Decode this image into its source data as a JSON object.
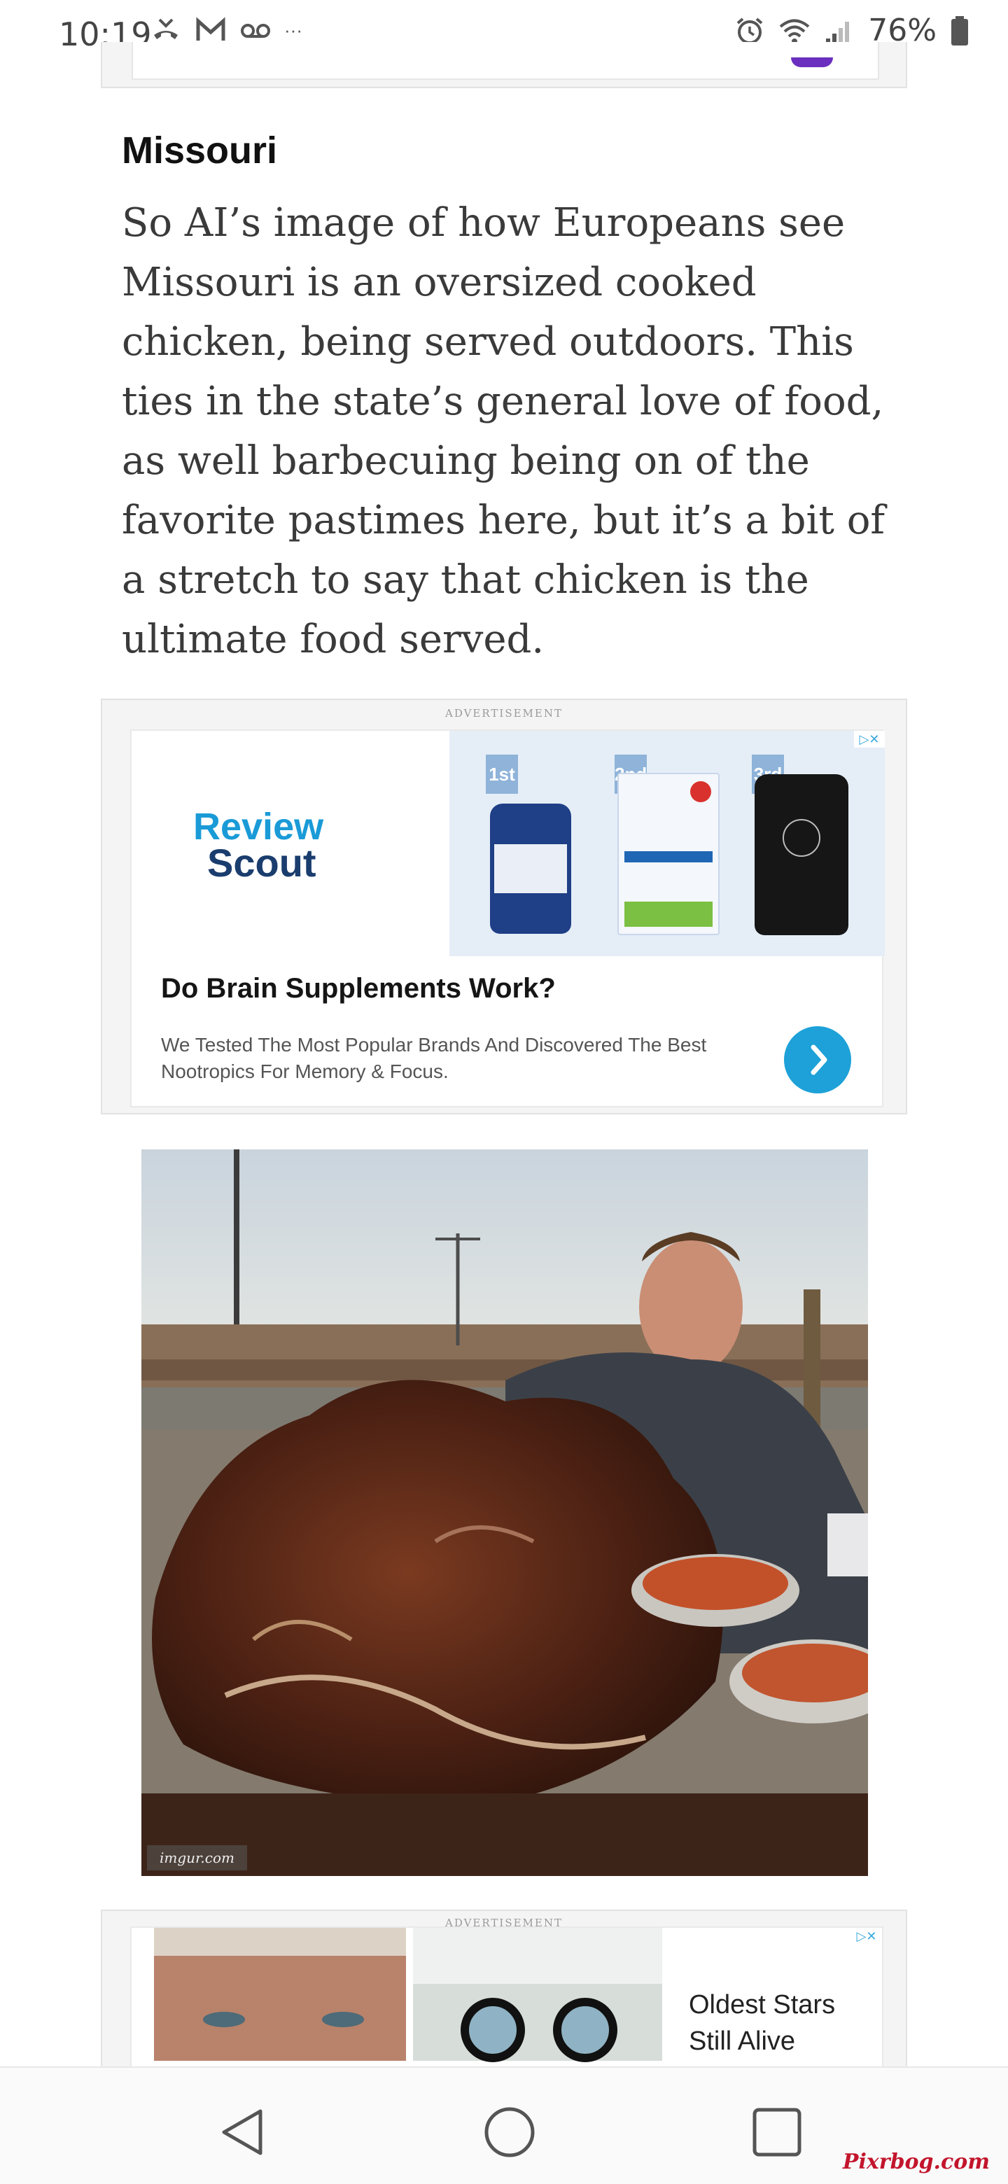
{
  "status_bar": {
    "time": "10:19",
    "overflow": "···",
    "battery": "76%",
    "left_icons": [
      "missed-call-icon",
      "gmail-icon",
      "voicemail-icon"
    ],
    "right_icons": [
      "alarm-icon",
      "wifi-icon",
      "signal-icon",
      "battery-icon"
    ]
  },
  "article": {
    "heading": "Missouri",
    "paragraph": "So AI’s image of how Europeans see Missouri is an oversized cooked chicken, being served outdoors. This ties in the state’s general love of food, as well barbecuing being on of the favorite pastimes here, but it’s a bit of a stretch to say that chicken is the ultimate food served."
  },
  "ad1": {
    "label": "ADVERTISEMENT",
    "brand_line1": "Review",
    "brand_line2": "Scout",
    "ranks": [
      "1st",
      "2nd",
      "3rd"
    ],
    "title": "Do Brain Supplements Work?",
    "description": "We Tested The Most Popular Brands And Discovered The Best Nootropics For Memory & Focus.",
    "close_label": "▷✕"
  },
  "photo": {
    "credit": "imgur.com"
  },
  "ad2": {
    "label": "ADVERTISEMENT",
    "title": "Oldest Stars Still Alive",
    "close_label": "▷✕"
  },
  "nav": {
    "back": "back-button",
    "home": "home-button",
    "recents": "recents-button"
  },
  "watermark": "Pixrbog.com",
  "colors": {
    "accent": "#1da1d8",
    "brand_blue": "#1a9bd7",
    "brand_navy": "#1a3d6e",
    "watermark": "#c2152c"
  }
}
